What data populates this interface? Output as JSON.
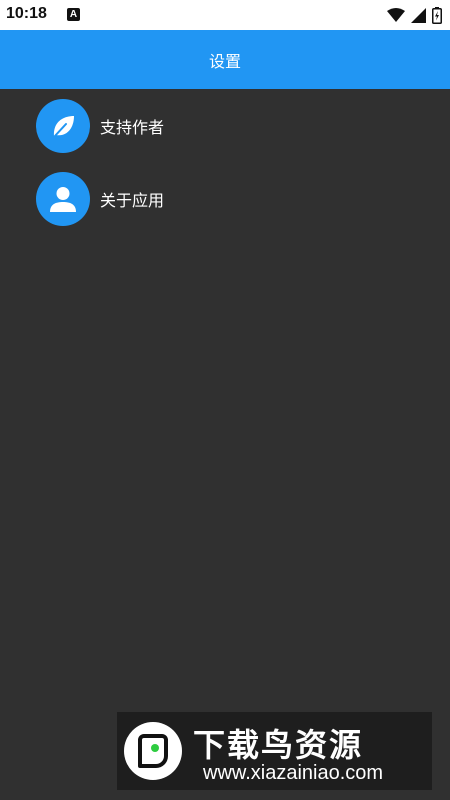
{
  "status_bar": {
    "time": "10:18",
    "notification_glyph": "A",
    "icons": [
      "wifi-icon",
      "signal-icon",
      "battery-icon"
    ]
  },
  "app_bar": {
    "title": "设置",
    "color": "#2196F3"
  },
  "settings": {
    "items": [
      {
        "label": "支持作者",
        "icon": "leaf-icon"
      },
      {
        "label": "关于应用",
        "icon": "person-icon"
      }
    ]
  },
  "watermark": {
    "title": "下载鸟资源",
    "url": "www.xiazainiao.com"
  },
  "colors": {
    "background": "#303030",
    "accent": "#2196F3"
  }
}
